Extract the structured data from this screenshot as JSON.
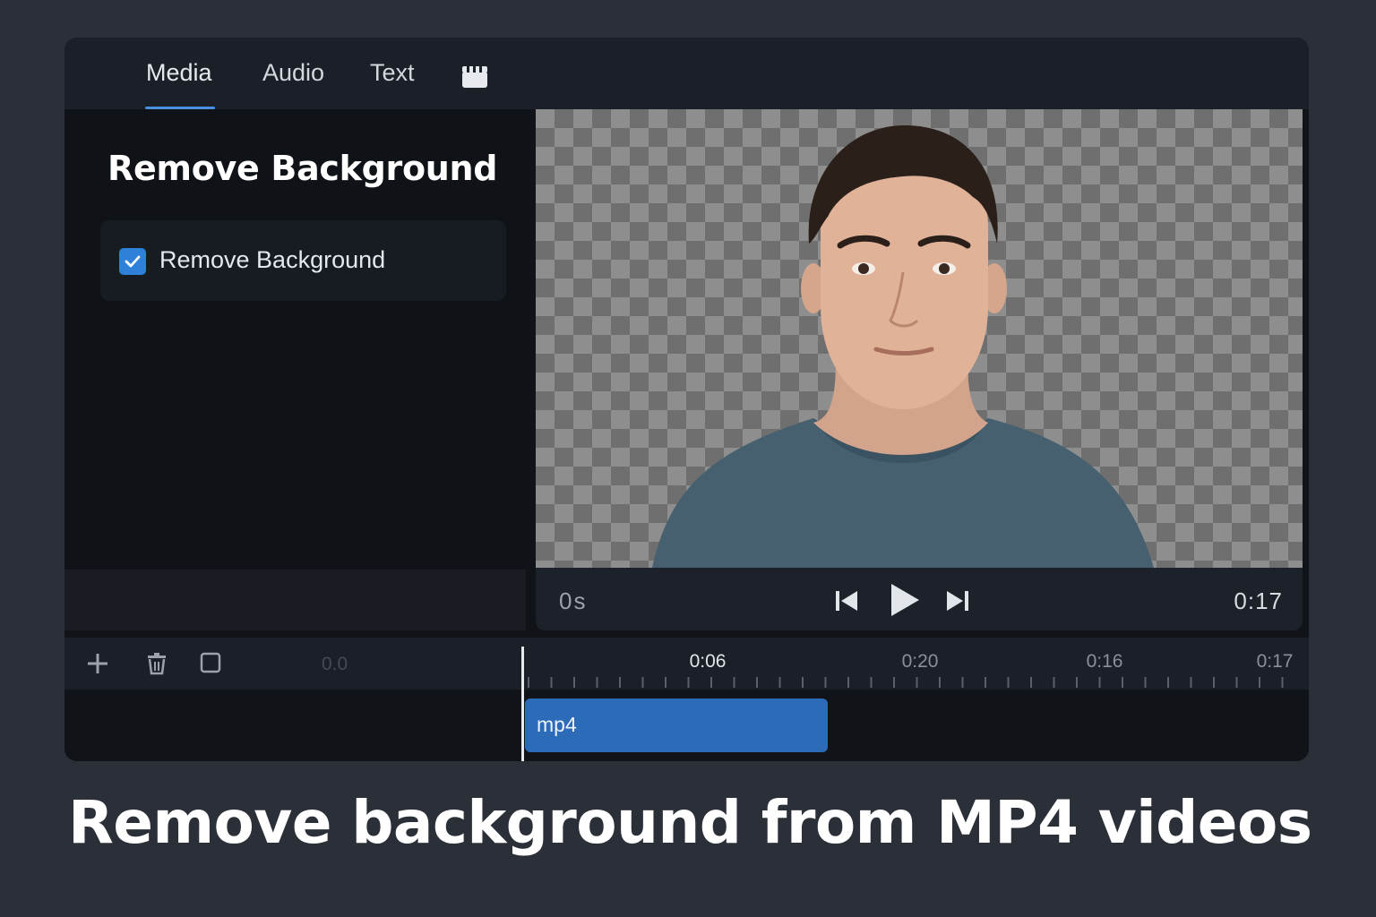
{
  "tabs": [
    {
      "label": "Media",
      "active": true
    },
    {
      "label": "Audio",
      "active": false
    },
    {
      "label": "Text",
      "active": false
    }
  ],
  "tab_icon": "clapperboard-icon",
  "panel": {
    "title": "Remove Background",
    "option_label": "Remove Background",
    "option_checked": true
  },
  "preview": {
    "subject": "person-portrait"
  },
  "player": {
    "time_start": "0s",
    "time_end": "0:17",
    "icons": [
      "skip-previous-icon",
      "play-icon",
      "skip-next-icon"
    ]
  },
  "timeline": {
    "tools": [
      "add-icon",
      "trash-icon",
      "square-select-icon"
    ],
    "zero_label": "0.0",
    "ticks": [
      "0:06",
      "0:20",
      "0:16",
      "0:17"
    ],
    "clip_label": "mp4"
  },
  "caption": "Remove background from MP4 videos",
  "colors": {
    "accent": "#2f80d8",
    "clip": "#2c6bb7",
    "background": "#2b2f38"
  }
}
